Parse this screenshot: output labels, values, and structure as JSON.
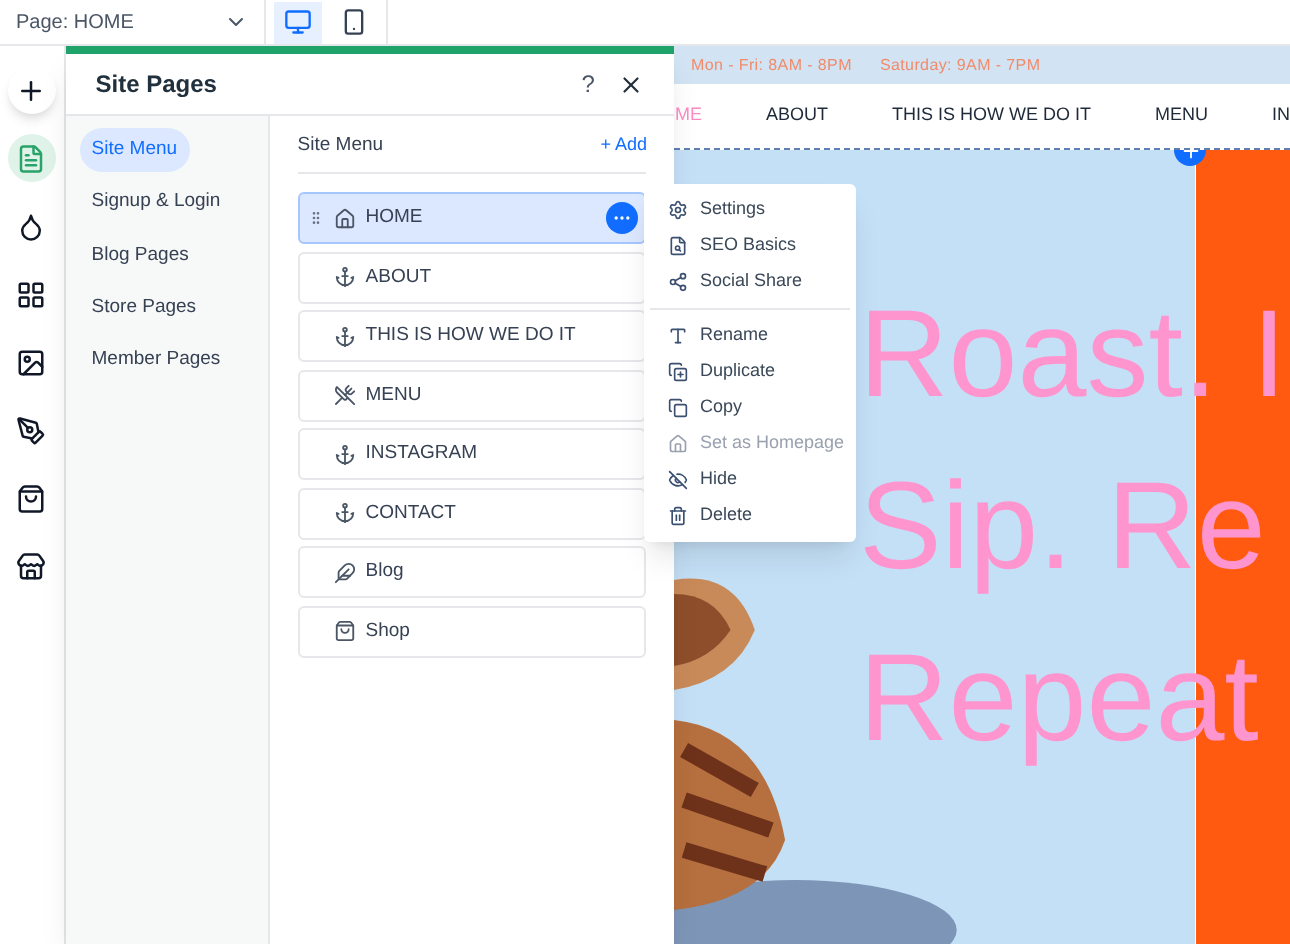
{
  "topbar": {
    "page_label": "Page: HOME",
    "devices": [
      {
        "kind": "desktop",
        "selected": true
      },
      {
        "kind": "mobile",
        "selected": false
      }
    ]
  },
  "rail": [
    {
      "kind": "add",
      "selected": false
    },
    {
      "kind": "pages",
      "selected": true
    },
    {
      "kind": "design",
      "selected": false
    },
    {
      "kind": "apps",
      "selected": false
    },
    {
      "kind": "media",
      "selected": false
    },
    {
      "kind": "blog",
      "selected": false
    },
    {
      "kind": "store",
      "selected": false
    },
    {
      "kind": "market",
      "selected": false
    }
  ],
  "panel": {
    "title": "Site Pages",
    "help": "?",
    "nav": [
      {
        "label": "Site Menu",
        "selected": true
      },
      {
        "label": "Signup & Login",
        "selected": false
      },
      {
        "label": "Blog Pages",
        "selected": false
      },
      {
        "label": "Store Pages",
        "selected": false
      },
      {
        "label": "Member Pages",
        "selected": false
      }
    ],
    "list_title": "Site Menu",
    "add_label": "+ Add",
    "pages": [
      {
        "label": "HOME",
        "kind": "home",
        "selected": true
      },
      {
        "label": "ABOUT",
        "kind": "anchor",
        "selected": false
      },
      {
        "label": "THIS IS HOW WE DO IT",
        "kind": "anchor",
        "selected": false
      },
      {
        "label": "MENU",
        "kind": "menu",
        "selected": false
      },
      {
        "label": "INSTAGRAM",
        "kind": "anchor",
        "selected": false
      },
      {
        "label": "CONTACT",
        "kind": "anchor",
        "selected": false
      },
      {
        "label": "Blog",
        "kind": "blog",
        "selected": false
      },
      {
        "label": "Shop",
        "kind": "shop",
        "selected": false
      }
    ]
  },
  "context_menu": [
    {
      "label": "Settings",
      "kind": "settings",
      "disabled": false
    },
    {
      "label": "SEO Basics",
      "kind": "seo",
      "disabled": false
    },
    {
      "label": "Social Share",
      "kind": "share",
      "disabled": false,
      "divider_after": true
    },
    {
      "label": "Rename",
      "kind": "rename",
      "disabled": false
    },
    {
      "label": "Duplicate",
      "kind": "duplicate",
      "disabled": false
    },
    {
      "label": "Copy",
      "kind": "copy",
      "disabled": false
    },
    {
      "label": "Set as Homepage",
      "kind": "home",
      "disabled": true
    },
    {
      "label": "Hide",
      "kind": "hide",
      "disabled": false
    },
    {
      "label": "Delete",
      "kind": "delete",
      "disabled": false
    }
  ],
  "site": {
    "hours": [
      "Mon - Fri: 8AM - 8PM",
      "Saturday: 9AM - 7PM"
    ],
    "nav": [
      {
        "label": "ME",
        "selected": true
      },
      {
        "label": "ABOUT",
        "selected": false
      },
      {
        "label": "THIS IS HOW WE DO IT",
        "selected": false
      },
      {
        "label": "MENU",
        "selected": false
      },
      {
        "label": "IN",
        "selected": false
      }
    ],
    "headline": [
      "Roast. I",
      "Sip. Re",
      "Repeat"
    ]
  }
}
